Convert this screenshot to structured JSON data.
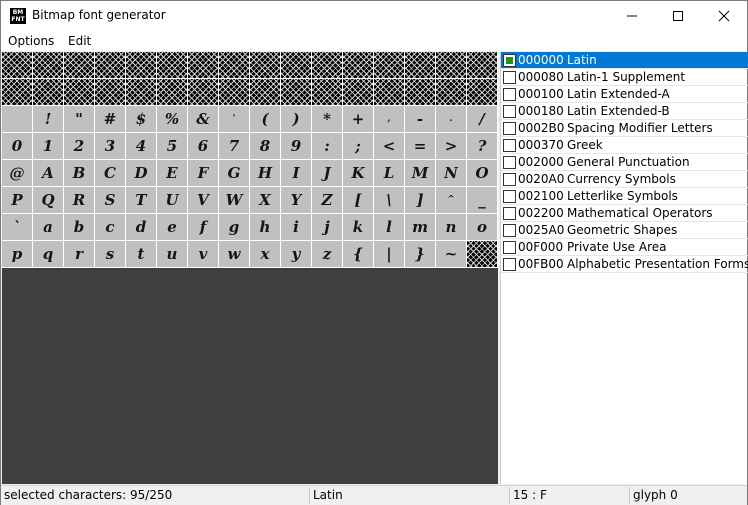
{
  "window": {
    "title": "Bitmap font generator",
    "app_icon": "BM\nFONT"
  },
  "menu": {
    "items": [
      "Options",
      "Edit"
    ]
  },
  "glyphs": [
    [
      "",
      "",
      "",
      "",
      "",
      "",
      "",
      "",
      "",
      "",
      "",
      "",
      "",
      "",
      "",
      ""
    ],
    [
      "",
      "",
      "",
      "",
      "",
      "",
      "",
      "",
      "",
      "",
      "",
      "",
      "",
      "",
      "",
      ""
    ],
    [
      "",
      "!",
      "\"",
      "#",
      "$",
      "%",
      "&",
      "'",
      "(",
      ")",
      "*",
      "+",
      ",",
      "-",
      ".",
      "/"
    ],
    [
      "0",
      "1",
      "2",
      "3",
      "4",
      "5",
      "6",
      "7",
      "8",
      "9",
      ":",
      ";",
      "<",
      "=",
      ">",
      "?"
    ],
    [
      "@",
      "A",
      "B",
      "C",
      "D",
      "E",
      "F",
      "G",
      "H",
      "I",
      "J",
      "K",
      "L",
      "M",
      "N",
      "O"
    ],
    [
      "P",
      "Q",
      "R",
      "S",
      "T",
      "U",
      "V",
      "W",
      "X",
      "Y",
      "Z",
      "[",
      "\\",
      "]",
      "^",
      "_"
    ],
    [
      "`",
      "a",
      "b",
      "c",
      "d",
      "e",
      "f",
      "g",
      "h",
      "i",
      "j",
      "k",
      "l",
      "m",
      "n",
      "o"
    ],
    [
      "p",
      "q",
      "r",
      "s",
      "t",
      "u",
      "v",
      "w",
      "x",
      "y",
      "z",
      "{",
      "|",
      "}",
      "~",
      ""
    ]
  ],
  "blocks": [
    {
      "code": "000000",
      "name": "Latin",
      "checked": true,
      "selected": true
    },
    {
      "code": "000080",
      "name": "Latin-1 Supplement",
      "checked": false,
      "selected": false
    },
    {
      "code": "000100",
      "name": "Latin Extended-A",
      "checked": false,
      "selected": false
    },
    {
      "code": "000180",
      "name": "Latin Extended-B",
      "checked": false,
      "selected": false
    },
    {
      "code": "0002B0",
      "name": "Spacing Modifier Letters",
      "checked": false,
      "selected": false
    },
    {
      "code": "000370",
      "name": "Greek",
      "checked": false,
      "selected": false
    },
    {
      "code": "002000",
      "name": "General Punctuation",
      "checked": false,
      "selected": false
    },
    {
      "code": "0020A0",
      "name": "Currency Symbols",
      "checked": false,
      "selected": false
    },
    {
      "code": "002100",
      "name": "Letterlike Symbols",
      "checked": false,
      "selected": false
    },
    {
      "code": "002200",
      "name": "Mathematical Operators",
      "checked": false,
      "selected": false
    },
    {
      "code": "0025A0",
      "name": "Geometric Shapes",
      "checked": false,
      "selected": false
    },
    {
      "code": "00F000",
      "name": "Private Use Area",
      "checked": false,
      "selected": false
    },
    {
      "code": "00FB00",
      "name": "Alphabetic Presentation Forms",
      "checked": false,
      "selected": false
    }
  ],
  "status": {
    "selected": "selected characters: 95/250",
    "block": "Latin",
    "position": "15 : F",
    "glyph": "glyph 0"
  },
  "colors": {
    "selection": "#0078d7",
    "check": "#1a9a1a",
    "grid_bg": "#3f3f3f",
    "cell_bg": "#c0c0c0"
  }
}
